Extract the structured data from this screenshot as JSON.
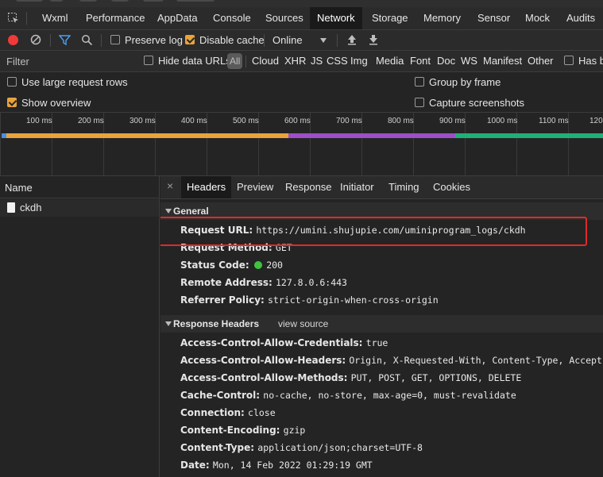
{
  "tabs": [
    {
      "label": "Wxml"
    },
    {
      "label": "Performance"
    },
    {
      "label": "AppData"
    },
    {
      "label": "Console"
    },
    {
      "label": "Sources"
    },
    {
      "label": "Network"
    },
    {
      "label": "Storage"
    },
    {
      "label": "Memory"
    },
    {
      "label": "Sensor"
    },
    {
      "label": "Mock"
    },
    {
      "label": "Audits"
    }
  ],
  "toolbar": {
    "preserve_log": "Preserve log",
    "disable_cache": "Disable cache",
    "throttle_value": "Online"
  },
  "filterbar": {
    "filter_label": "Filter",
    "hide_data_urls": "Hide data URLs",
    "types": [
      "All",
      "Cloud",
      "XHR",
      "JS",
      "CSS",
      "Img",
      "Media",
      "Font",
      "Doc",
      "WS",
      "Manifest",
      "Other"
    ],
    "has_blocked": "Has bl"
  },
  "options": {
    "large_rows": "Use large request rows",
    "group_by_frame": "Group by frame",
    "show_overview": "Show overview",
    "capture_screenshots": "Capture screenshots"
  },
  "timeline": {
    "ticks": [
      "100 ms",
      "200 ms",
      "300 ms",
      "400 ms",
      "500 ms",
      "600 ms",
      "700 ms",
      "800 ms",
      "900 ms",
      "1000 ms",
      "1100 ms",
      "120"
    ],
    "colors": {
      "waiting": "#e8a33d",
      "purple": "#9c4fc9",
      "green": "#1fb07a",
      "blue": "#4a90e2"
    }
  },
  "requests": {
    "header": "Name",
    "items": [
      {
        "name": "ckdh"
      }
    ]
  },
  "detail_tabs": [
    "Headers",
    "Preview",
    "Response",
    "Initiator",
    "Timing",
    "Cookies"
  ],
  "general": {
    "title": "General",
    "rows": [
      {
        "key": "Request URL:",
        "value": "https://umini.shujupie.com/uminiprogram_logs/ckdh"
      },
      {
        "key": "Request Method:",
        "value": "GET"
      },
      {
        "key": "Status Code:",
        "value": "200"
      },
      {
        "key": "Remote Address:",
        "value": "127.8.0.6:443"
      },
      {
        "key": "Referrer Policy:",
        "value": "strict-origin-when-cross-origin"
      }
    ],
    "status_color": "#3fc33f"
  },
  "response_headers": {
    "title": "Response Headers",
    "view_source": "view source",
    "rows": [
      {
        "key": "Access-Control-Allow-Credentials:",
        "value": "true"
      },
      {
        "key": "Access-Control-Allow-Headers:",
        "value": "Origin, X-Requested-With, Content-Type, Accept, Autho"
      },
      {
        "key": "Access-Control-Allow-Methods:",
        "value": "PUT, POST, GET, OPTIONS, DELETE"
      },
      {
        "key": "Cache-Control:",
        "value": "no-cache, no-store, max-age=0, must-revalidate"
      },
      {
        "key": "Connection:",
        "value": "close"
      },
      {
        "key": "Content-Encoding:",
        "value": "gzip"
      },
      {
        "key": "Content-Type:",
        "value": "application/json;charset=UTF-8"
      },
      {
        "key": "Date:",
        "value": "Mon, 14 Feb 2022 01:29:19 GMT"
      }
    ]
  }
}
